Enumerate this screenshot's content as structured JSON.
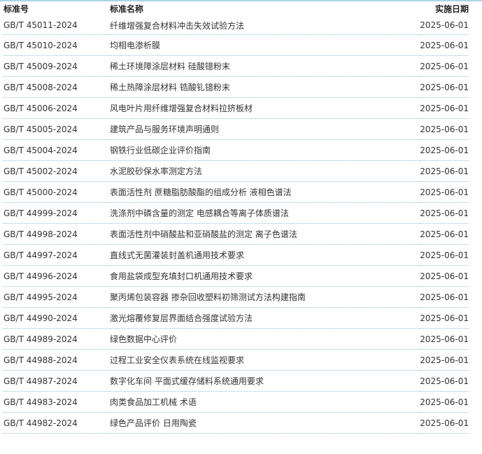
{
  "table": {
    "headers": {
      "code": "标准号",
      "name": "标准名称",
      "date": "实施日期"
    },
    "rows": [
      {
        "code": "GB/T 45011-2024",
        "name": "纤维增强复合材料冲击失效试验方法",
        "date": "2025-06-01"
      },
      {
        "code": "GB/T 45010-2024",
        "name": "均相电渗析膜",
        "date": "2025-06-01"
      },
      {
        "code": "GB/T 45009-2024",
        "name": "稀土环境障涂层材料 硅酸镱粉末",
        "date": "2025-06-01"
      },
      {
        "code": "GB/T 45008-2024",
        "name": "稀土热障涂层材料 锆酸钆镱粉末",
        "date": "2025-06-01"
      },
      {
        "code": "GB/T 45006-2024",
        "name": "风电叶片用纤维增强复合材料拉挤板材",
        "date": "2025-06-01"
      },
      {
        "code": "GB/T 45005-2024",
        "name": "建筑产品与服务环境声明通则",
        "date": "2025-06-01"
      },
      {
        "code": "GB/T 45004-2024",
        "name": "钢铁行业低碳企业评价指南",
        "date": "2025-06-01"
      },
      {
        "code": "GB/T 45002-2024",
        "name": "水泥胶砂保水率测定方法",
        "date": "2025-06-01"
      },
      {
        "code": "GB/T 45000-2024",
        "name": "表面活性剂 蔗糖脂肪酸酯的组成分析 液相色谱法",
        "date": "2025-06-01"
      },
      {
        "code": "GB/T 44999-2024",
        "name": "洗涤剂中磷含量的测定 电感耦合等离子体质谱法",
        "date": "2025-06-01"
      },
      {
        "code": "GB/T 44998-2024",
        "name": "表面活性剂中硝酸盐和亚硝酸盐的测定 离子色谱法",
        "date": "2025-06-01"
      },
      {
        "code": "GB/T 44997-2024",
        "name": "直线式无菌灌装封盖机通用技术要求",
        "date": "2025-06-01"
      },
      {
        "code": "GB/T 44996-2024",
        "name": "食用盐袋成型充填封口机通用技术要求",
        "date": "2025-06-01"
      },
      {
        "code": "GB/T 44995-2024",
        "name": "聚丙烯包装容器 掺杂回收塑料初筛测试方法构建指南",
        "date": "2025-06-01"
      },
      {
        "code": "GB/T 44990-2024",
        "name": "激光熔覆修复层界面结合强度试验方法",
        "date": "2025-06-01"
      },
      {
        "code": "GB/T 44989-2024",
        "name": "绿色数据中心评价",
        "date": "2025-06-01"
      },
      {
        "code": "GB/T 44988-2024",
        "name": "过程工业安全仪表系统在线监视要求",
        "date": "2025-06-01"
      },
      {
        "code": "GB/T 44987-2024",
        "name": "数字化车间 平面式缓存储料系统通用要求",
        "date": "2025-06-01"
      },
      {
        "code": "GB/T 44983-2024",
        "name": "肉类食品加工机械 术语",
        "date": "2025-06-01"
      },
      {
        "code": "GB/T 44982-2024",
        "name": "绿色产品评价 日用陶瓷",
        "date": "2025-06-01"
      }
    ]
  }
}
